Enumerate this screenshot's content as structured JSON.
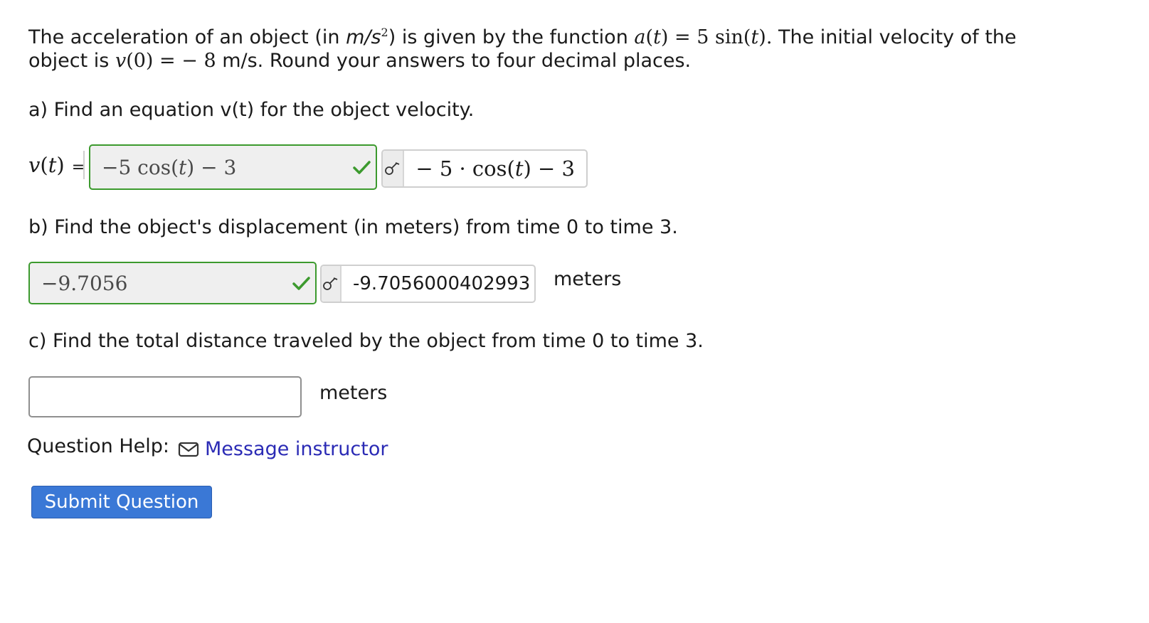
{
  "intro": {
    "line1_a": "The acceleration of an object (in ",
    "line1_unit_m": "m/s",
    "line1_unit_exp": "2",
    "line1_b": ") is given by the function ",
    "line1_func_lhs": "a",
    "line1_func_arg": "t",
    "line1_func_eq": " = 5 sin(",
    "line1_func_arg2": "t",
    "line1_func_close": ").",
    "line1_c": " The initial velocity of the",
    "line2_a": "object is ",
    "line2_v": "v",
    "line2_v0": "(0)",
    "line2_eq": " = − 8",
    "line2_b": " m/s. Round your answers to four decimal places."
  },
  "part_a": {
    "question": "a) Find an equation v(t) for the object velocity.",
    "label_v": "v",
    "label_t": "t",
    "label_eq": "=",
    "answer": "−5 cos(t) − 3",
    "answer_pre": "−5 cos(",
    "answer_t": "t",
    "answer_post": ") − 3",
    "preview_pre": "− 5 · cos(",
    "preview_t": "t",
    "preview_post": ") − 3",
    "status": "correct"
  },
  "part_b": {
    "question": "b) Find the object's displacement (in meters) from time 0 to time 3.",
    "answer": "−9.7056",
    "preview": "-9.7056000402993",
    "unit": "meters",
    "status": "correct"
  },
  "part_c": {
    "question": "c) Find the total distance traveled by the object from time 0 to time 3.",
    "answer": "",
    "unit": "meters"
  },
  "help": {
    "label": "Question Help:",
    "link_label": "Message instructor",
    "link_icon": "envelope-icon"
  },
  "submit_label": "Submit Question",
  "colors": {
    "correct_border": "#3c9a2e",
    "link": "#2b2bb5",
    "submit_bg": "#3a78d6"
  }
}
